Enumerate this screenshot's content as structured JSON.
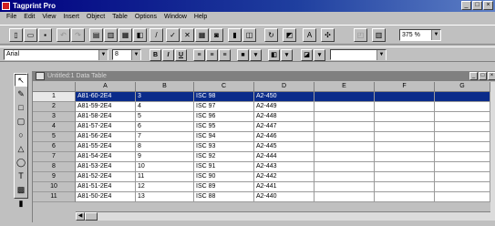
{
  "app": {
    "title": "Tagprint Pro"
  },
  "window_controls": {
    "minimize": "_",
    "maximize": "□",
    "close": "×"
  },
  "menu": [
    "File",
    "Edit",
    "View",
    "Insert",
    "Object",
    "Table",
    "Options",
    "Window",
    "Help"
  ],
  "toolbar": {
    "zoom_value": "375 %",
    "icons": [
      "new-document-icon",
      "open-folder-icon",
      "save-icon",
      "undo-icon",
      "redo-icon",
      "cut-icon",
      "copy-icon",
      "paste-icon",
      "print-icon",
      "pencil-icon",
      "spellcheck-icon",
      "delete-icon",
      "table-icon",
      "image-icon",
      "barcode-icon",
      "group-icon",
      "rotate-icon",
      "properties-icon",
      "text-icon",
      "grid-icon",
      "merge-icon",
      "layout-icon"
    ]
  },
  "format_bar": {
    "font": "Arial",
    "size": "8",
    "bold_label": "B",
    "italic_label": "I",
    "underline_label": "U"
  },
  "document": {
    "title": "Untitled:1 Data Table",
    "columns": [
      "A",
      "B",
      "C",
      "D",
      "E",
      "F",
      "G"
    ],
    "rows": [
      {
        "num": "1",
        "A": "A81-60-2E4",
        "B": "3",
        "C": "ISC 98",
        "D": "A2-450"
      },
      {
        "num": "2",
        "A": "A81-59-2E4",
        "B": "4",
        "C": "ISC 97",
        "D": "A2-449"
      },
      {
        "num": "3",
        "A": "A81-58-2E4",
        "B": "5",
        "C": "ISC 96",
        "D": "A2-448"
      },
      {
        "num": "4",
        "A": "A81-57-2E4",
        "B": "6",
        "C": "ISC 95",
        "D": "A2-447"
      },
      {
        "num": "5",
        "A": "A81-56-2E4",
        "B": "7",
        "C": "ISC 94",
        "D": "A2-446"
      },
      {
        "num": "6",
        "A": "A81-55-2E4",
        "B": "8",
        "C": "ISC 93",
        "D": "A2-445"
      },
      {
        "num": "7",
        "A": "A81-54-2E4",
        "B": "9",
        "C": "ISC 92",
        "D": "A2-444"
      },
      {
        "num": "8",
        "A": "A81-53-2E4",
        "B": "10",
        "C": "ISC 91",
        "D": "A2-443"
      },
      {
        "num": "9",
        "A": "A81-52-2E4",
        "B": "11",
        "C": "ISC 90",
        "D": "A2-442"
      },
      {
        "num": "10",
        "A": "A81-51-2E4",
        "B": "12",
        "C": "ISC 89",
        "D": "A2-441"
      },
      {
        "num": "11",
        "A": "A81-50-2E4",
        "B": "13",
        "C": "ISC 88",
        "D": "A2-440"
      }
    ],
    "selected_row": "1"
  },
  "tools": [
    "arrow-tool-icon",
    "pencil-tool-icon",
    "rectangle-tool-icon",
    "rounded-rect-tool-icon",
    "ellipse-tool-icon",
    "triangle-tool-icon",
    "circle-tool-icon",
    "text-tool-icon",
    "picture-tool-icon",
    "barcode-tool-icon"
  ],
  "colors": {
    "title_bar": "#000080",
    "selection": "#0a2b8a",
    "chrome": "#c0c0c0"
  }
}
